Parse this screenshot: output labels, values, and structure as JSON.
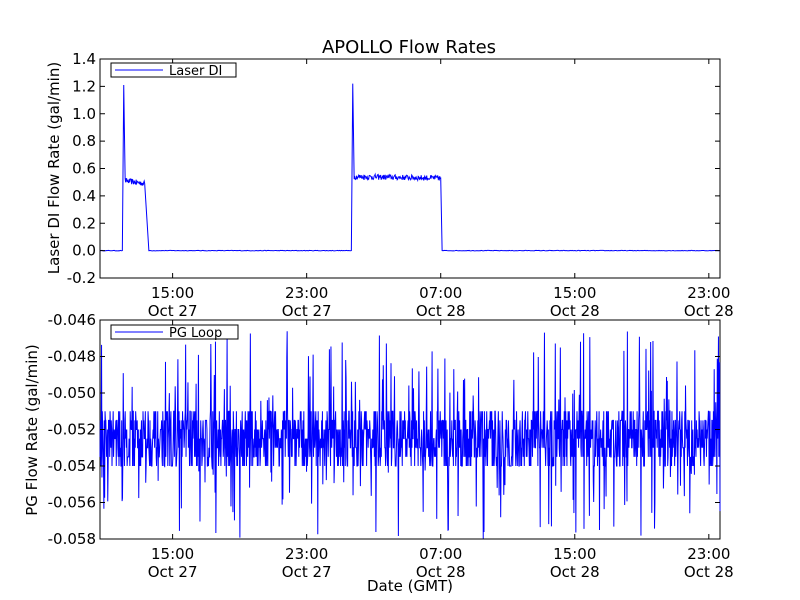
{
  "chart_data": [
    {
      "type": "line",
      "title": "APOLLO Flow Rates",
      "xlabel": "",
      "ylabel": "Laser DI Flow Rate (gal/min)",
      "ylim": [
        -0.2,
        1.4
      ],
      "yticks": [
        "-0.2",
        "0.0",
        "0.2",
        "0.4",
        "0.6",
        "0.8",
        "1.0",
        "1.2",
        "1.4"
      ],
      "x_range": [
        "Oct 27 10:40",
        "Oct 28 23:40"
      ],
      "xticks": [
        {
          "time": "15:00",
          "date": "Oct 27"
        },
        {
          "time": "23:00",
          "date": "Oct 27"
        },
        {
          "time": "07:00",
          "date": "Oct 28"
        },
        {
          "time": "15:00",
          "date": "Oct 28"
        },
        {
          "time": "23:00",
          "date": "Oct 28"
        }
      ],
      "legend": {
        "placement": "top-left"
      },
      "grid": false,
      "series": [
        {
          "name": "Laser DI",
          "color": "#0000ff",
          "x": [
            "Oct 27 10:40",
            "Oct 27 12:00",
            "Oct 27 12:05",
            "Oct 27 12:10",
            "Oct 27 13:20",
            "Oct 27 13:35",
            "Oct 28 01:40",
            "Oct 28 01:45",
            "Oct 28 01:50",
            "Oct 28 07:00",
            "Oct 28 07:05",
            "Oct 28 23:40"
          ],
          "y": [
            0.0,
            0.0,
            1.21,
            0.51,
            0.49,
            0.0,
            0.0,
            1.22,
            0.54,
            0.53,
            0.0,
            0.0
          ]
        }
      ]
    },
    {
      "type": "line",
      "title": "",
      "xlabel": "Date (GMT)",
      "ylabel": "PG Flow Rate (gal/min)",
      "ylim": [
        -0.058,
        -0.046
      ],
      "yticks": [
        "-0.058",
        "-0.056",
        "-0.054",
        "-0.052",
        "-0.050",
        "-0.048",
        "-0.046"
      ],
      "x_range": [
        "Oct 27 10:40",
        "Oct 28 23:40"
      ],
      "xticks": [
        {
          "time": "15:00",
          "date": "Oct 27"
        },
        {
          "time": "23:00",
          "date": "Oct 27"
        },
        {
          "time": "07:00",
          "date": "Oct 28"
        },
        {
          "time": "15:00",
          "date": "Oct 28"
        },
        {
          "time": "23:00",
          "date": "Oct 28"
        }
      ],
      "legend": {
        "placement": "top-left"
      },
      "grid": false,
      "series": [
        {
          "name": "PG Loop",
          "color": "#0000ff",
          "typical_band": [
            -0.054,
            -0.051
          ],
          "mean": -0.0525,
          "extreme_range": [
            -0.058,
            -0.0466
          ]
        }
      ]
    }
  ]
}
